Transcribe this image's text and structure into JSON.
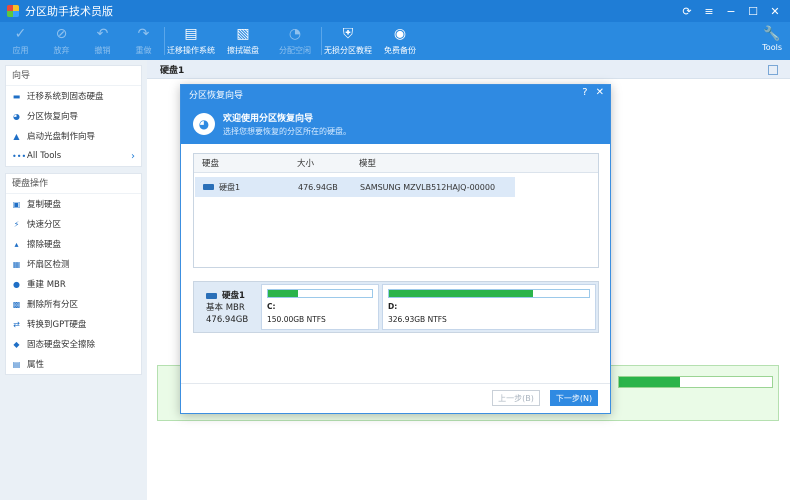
{
  "app": {
    "title": "分区助手技术员版"
  },
  "toolbar": {
    "buttons": [
      {
        "label": "应用",
        "icon": "check-icon",
        "glyph": "✓",
        "disabled": true
      },
      {
        "label": "放弃",
        "icon": "discard-icon",
        "glyph": "⊘",
        "disabled": true
      },
      {
        "label": "撤销",
        "icon": "undo-icon",
        "glyph": "↶",
        "disabled": true
      },
      {
        "label": "重做",
        "icon": "redo-icon",
        "glyph": "↷",
        "disabled": true
      },
      {
        "label": "迁移操作系统",
        "icon": "migrate-os-icon",
        "glyph": "▤",
        "disabled": false
      },
      {
        "label": "擦拭磁盘",
        "icon": "wipe-disk-icon",
        "glyph": "▧",
        "disabled": false
      },
      {
        "label": "分配空闲",
        "icon": "allocate-space-icon",
        "glyph": "◔",
        "disabled": true
      },
      {
        "label": "无损分区教程",
        "icon": "shield-icon",
        "glyph": "⛨",
        "disabled": false
      },
      {
        "label": "免费备份",
        "icon": "backup-icon",
        "glyph": "◉",
        "disabled": false
      }
    ],
    "tools_label": "Tools"
  },
  "sidebar": {
    "wizard_title": "向导",
    "wizard_items": [
      {
        "label": "迁移系统到固态硬盘",
        "icon": "migrate-icon",
        "glyph": "▬"
      },
      {
        "label": "分区恢复向导",
        "icon": "recovery-icon",
        "glyph": "◕"
      },
      {
        "label": "启动光盘制作向导",
        "icon": "bootdisk-icon",
        "glyph": "▲"
      },
      {
        "label": "All Tools",
        "icon": "more-icon",
        "glyph": "•••"
      }
    ],
    "disk_ops_title": "硬盘操作",
    "disk_ops_items": [
      {
        "label": "复制硬盘",
        "icon": "copy-disk-icon",
        "glyph": "▣"
      },
      {
        "label": "快速分区",
        "icon": "quick-partition-icon",
        "glyph": "⚡"
      },
      {
        "label": "擦除硬盘",
        "icon": "erase-disk-icon",
        "glyph": "▴"
      },
      {
        "label": "坏扇区检测",
        "icon": "bad-sector-icon",
        "glyph": "▦"
      },
      {
        "label": "重建 MBR",
        "icon": "rebuild-mbr-icon",
        "glyph": "●"
      },
      {
        "label": "删除所有分区",
        "icon": "delete-partitions-icon",
        "glyph": "▩"
      },
      {
        "label": "转换到GPT硬盘",
        "icon": "convert-gpt-icon",
        "glyph": "⇄"
      },
      {
        "label": "固态硬盘安全擦除",
        "icon": "ssd-erase-icon",
        "glyph": "◆"
      },
      {
        "label": "属性",
        "icon": "properties-icon",
        "glyph": "▤"
      }
    ]
  },
  "main": {
    "header": "硬盘1"
  },
  "dialog": {
    "title": "分区恢复向导",
    "banner_title": "欢迎使用分区恢复向导",
    "banner_subtitle": "选择您想要恢复的分区所在的硬盘。",
    "table_headers": [
      "硬盘",
      "大小",
      "模型"
    ],
    "rows": [
      {
        "disk": "硬盘1",
        "size": "476.94GB",
        "model": "SAMSUNG MZVLB512HAJQ-00000"
      }
    ],
    "map": {
      "disk_name": "硬盘1",
      "disk_type": "基本 MBR",
      "disk_size": "476.94GB",
      "partitions": [
        {
          "label": "C:",
          "info": "150.00GB NTFS",
          "used_fraction": 0.29
        },
        {
          "label": "D:",
          "info": "326.93GB NTFS",
          "used_fraction": 0.72
        }
      ]
    },
    "prev_label": "上一步(B)",
    "next_label": "下一步(N)"
  }
}
